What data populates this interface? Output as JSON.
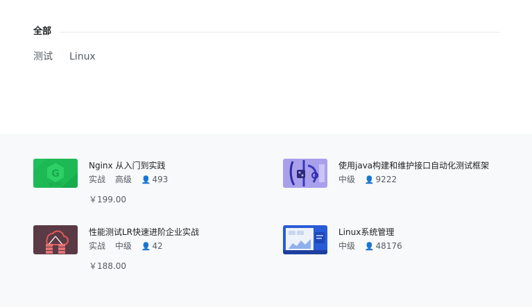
{
  "section": {
    "title": "全部",
    "tags": [
      "测试",
      "Linux"
    ]
  },
  "courses": [
    {
      "title": "Nginx 从入门到实践",
      "type": "实战",
      "level": "高级",
      "learners": "493",
      "price": "￥199.00",
      "thumb_icon": "nginx-logo-thumbnail",
      "thumb_color": "#1db954"
    },
    {
      "title": "使用java构建和维护接口自动化测试框架",
      "type": "",
      "level": "中级",
      "learners": "9222",
      "price": "",
      "thumb_icon": "java-test-framework-thumbnail",
      "thumb_color": "#7b6fe0"
    },
    {
      "title": "性能测试LR快速进阶企业实战",
      "type": "实战",
      "level": "中级",
      "learners": "42",
      "price": "￥188.00",
      "thumb_icon": "cloud-server-thumbnail",
      "thumb_color": "#5a3a45"
    },
    {
      "title": "Linux系统管理",
      "type": "",
      "level": "中级",
      "learners": "48176",
      "price": "",
      "thumb_icon": "linux-dashboard-thumbnail",
      "thumb_color": "#2a5bd7"
    }
  ],
  "icons": {
    "users": "person-icon"
  },
  "colors": {
    "page_bg": "#ffffff",
    "list_bg": "#f8f9fa",
    "text_primary": "#1c1f21",
    "text_secondary": "#545c63"
  }
}
